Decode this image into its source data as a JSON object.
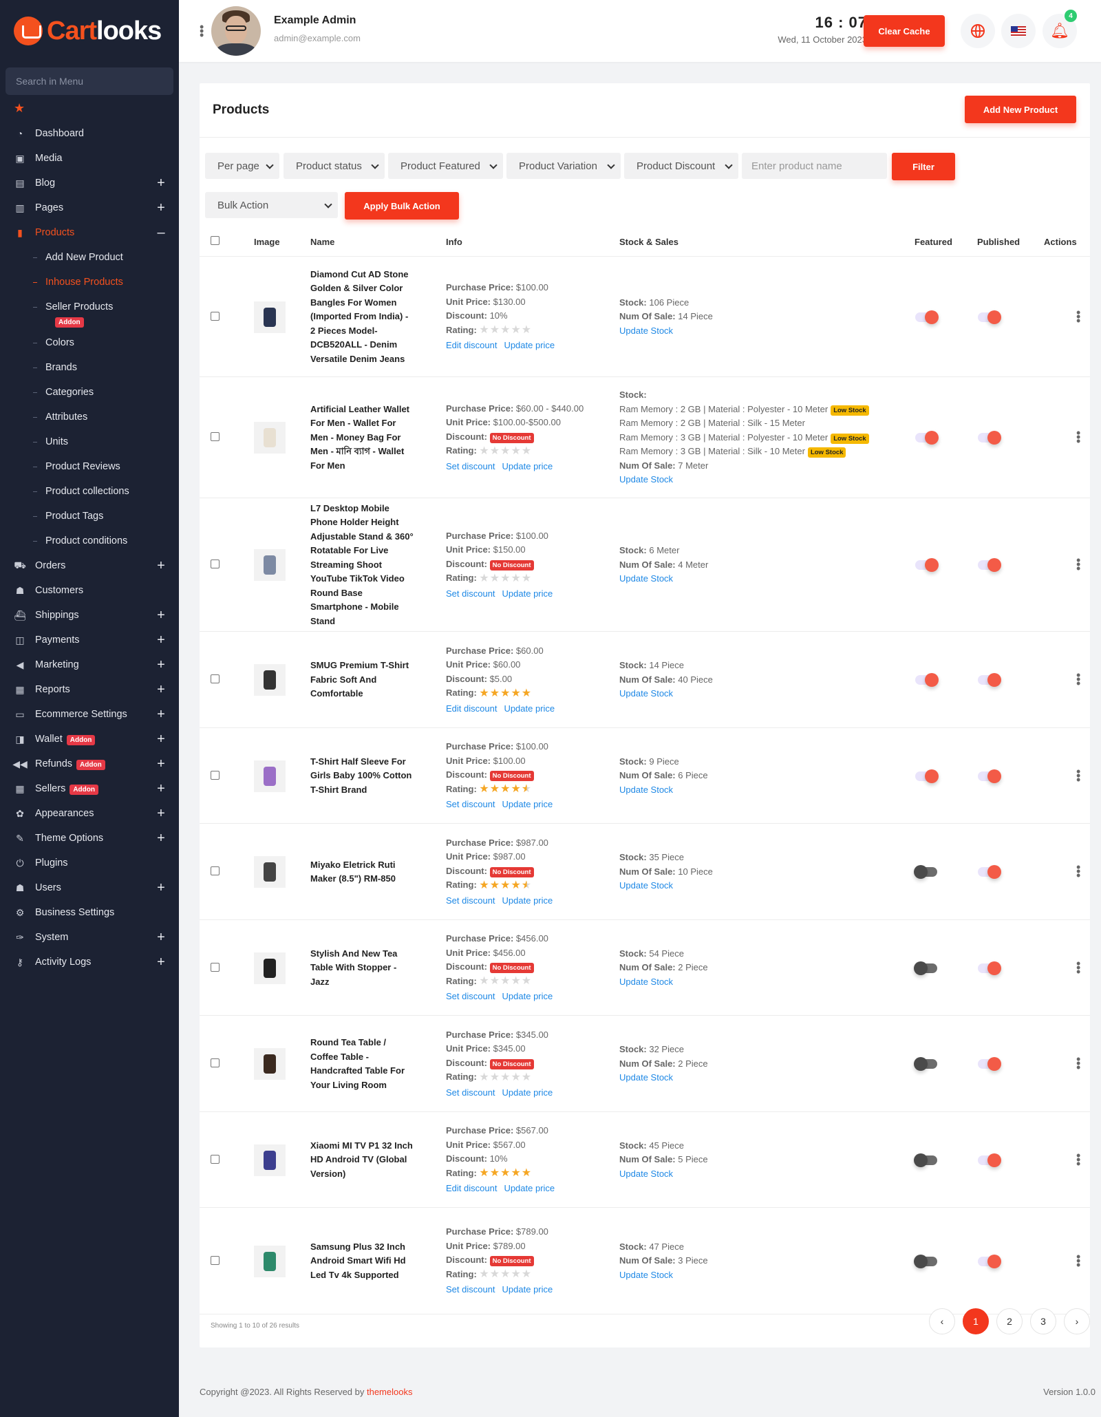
{
  "brand": {
    "part1": "Cart",
    "part2": "looks"
  },
  "sidebar": {
    "search_placeholder": "Search in Menu",
    "items": [
      {
        "label": "Dashboard",
        "icon": "speedometer-icon",
        "expandable": false
      },
      {
        "label": "Media",
        "icon": "media-icon",
        "expandable": false
      },
      {
        "label": "Blog",
        "icon": "blog-icon",
        "expandable": true
      },
      {
        "label": "Pages",
        "icon": "pages-icon",
        "expandable": true
      },
      {
        "label": "Products",
        "icon": "bag-icon",
        "expandable": true,
        "active": true
      }
    ],
    "product_sub": [
      "Add New Product",
      "Inhouse Products",
      "Seller Products",
      "Colors",
      "Brands",
      "Categories",
      "Attributes",
      "Units",
      "Product Reviews",
      "Product collections",
      "Product Tags",
      "Product conditions"
    ],
    "addon_label": "Addon",
    "items2": [
      {
        "label": "Orders",
        "icon": "cart-icon",
        "expandable": true
      },
      {
        "label": "Customers",
        "icon": "users-icon",
        "expandable": false
      },
      {
        "label": "Shippings",
        "icon": "ship-icon",
        "expandable": true
      },
      {
        "label": "Payments",
        "icon": "wallet-icon",
        "expandable": true
      },
      {
        "label": "Marketing",
        "icon": "megaphone-icon",
        "expandable": true
      },
      {
        "label": "Reports",
        "icon": "report-icon",
        "expandable": true
      },
      {
        "label": "Ecommerce Settings",
        "icon": "window-icon",
        "expandable": true
      },
      {
        "label": "Wallet",
        "icon": "wallet2-icon",
        "expandable": true,
        "addon": true
      },
      {
        "label": "Refunds",
        "icon": "rewind-icon",
        "expandable": true,
        "addon": true
      },
      {
        "label": "Sellers",
        "icon": "seller-icon",
        "expandable": true,
        "addon": true
      },
      {
        "label": "Appearances",
        "icon": "palette-icon",
        "expandable": true
      },
      {
        "label": "Theme Options",
        "icon": "brush-icon",
        "expandable": true
      },
      {
        "label": "Plugins",
        "icon": "plug-icon",
        "expandable": false
      },
      {
        "label": "Users",
        "icon": "users-icon",
        "expandable": true
      },
      {
        "label": "Business Settings",
        "icon": "gears-icon",
        "expandable": false
      },
      {
        "label": "System",
        "icon": "wrench-icon",
        "expandable": true
      },
      {
        "label": "Activity Logs",
        "icon": "key-icon",
        "expandable": true
      }
    ]
  },
  "header": {
    "user_name": "Example Admin",
    "user_email": "admin@example.com",
    "time": "16 : 07",
    "date": "Wed, 11 October 2023",
    "clear_cache": "Clear Cache",
    "notifications": "4"
  },
  "page": {
    "title": "Products",
    "add_button": "Add New Product",
    "filters": {
      "per_page": "Per page",
      "status": "Product status",
      "featured": "Product Featured",
      "variation": "Product Variation",
      "discount": "Product Discount",
      "name_placeholder": "Enter product name",
      "filter_button": "Filter",
      "bulk_action": "Bulk Action",
      "apply_bulk": "Apply Bulk Action"
    },
    "columns": {
      "image": "Image",
      "name": "Name",
      "info": "Info",
      "stock": "Stock & Sales",
      "featured": "Featured",
      "published": "Published",
      "actions": "Actions"
    },
    "labels": {
      "purchase_price": "Purchase Price:",
      "unit_price": "Unit Price:",
      "discount": "Discount:",
      "rating": "Rating:",
      "stock": "Stock:",
      "num_sale": "Num Of Sale:",
      "update_stock": "Update Stock",
      "update_price": "Update price",
      "no_discount": "No Discount",
      "low_stock": "Low Stock"
    },
    "products": [
      {
        "name": "Diamond Cut AD Stone Golden & Silver Color Bangles For Women (Imported From India) - 2 Pieces Model-DCB520ALL - Denim Versatile Denim Jeans",
        "purchase": "$100.00",
        "unit": "$130.00",
        "discount": "10%",
        "rating": 0,
        "discount_link": "Edit discount",
        "stock": "106 Piece",
        "sales": "14 Piece",
        "featured": true,
        "published": true,
        "icon": "jacket-icon",
        "color": "#2a3552"
      },
      {
        "name": "Artificial Leather Wallet For Men - Wallet For Men - Money Bag For Men - মানি ব্যাগ - Wallet For Men",
        "purchase": "$60.00 - $440.00",
        "unit": "$100.00-$500.00",
        "discount": null,
        "rating": 0,
        "discount_link": "Set discount",
        "stock": null,
        "variants": [
          {
            "text": "Ram Memory : 2 GB | Material : Polyester - 10 Meter",
            "low": true
          },
          {
            "text": "Ram Memory : 2 GB | Material : Silk - 15 Meter",
            "low": false
          },
          {
            "text": "Ram Memory : 3 GB | Material : Polyester - 10 Meter",
            "low": true
          },
          {
            "text": "Ram Memory : 3 GB | Material : Silk - 10 Meter",
            "low": true
          }
        ],
        "sales": "7 Meter",
        "featured": true,
        "published": true,
        "icon": "dress-icon",
        "color": "#e8e0d2"
      },
      {
        "name": "L7 Desktop Mobile Phone Holder Height Adjustable Stand & 360° Rotatable For Live Streaming Shoot YouTube TikTok Video Round Base Smartphone - Mobile Stand",
        "purchase": "$100.00",
        "unit": "$150.00",
        "discount": null,
        "rating": 0,
        "discount_link": "Set discount",
        "stock": "6 Meter",
        "sales": "4 Meter",
        "featured": true,
        "published": true,
        "icon": "coat-icon",
        "color": "#7d8aa3"
      },
      {
        "name": "SMUG Premium T-Shirt Fabric Soft And Comfortable",
        "purchase": "$60.00",
        "unit": "$60.00",
        "discount": "$5.00",
        "rating": 5,
        "discount_link": "Edit discount",
        "stock": "14 Piece",
        "sales": "40 Piece",
        "featured": true,
        "published": true,
        "icon": "speaker-icon",
        "color": "#333333"
      },
      {
        "name": "T-Shirt Half Sleeve For Girls Baby 100% Cotton T-Shirt Brand",
        "purchase": "$100.00",
        "unit": "$100.00",
        "discount": null,
        "rating": 4.5,
        "discount_link": "Set discount",
        "stock": "9 Piece",
        "sales": "6 Piece",
        "featured": true,
        "published": true,
        "icon": "frock-icon",
        "color": "#9b6fc7"
      },
      {
        "name": "Miyako Eletrick Ruti Maker (8.5\") RM-850",
        "purchase": "$987.00",
        "unit": "$987.00",
        "discount": null,
        "rating": 4.5,
        "discount_link": "Set discount",
        "stock": "35 Piece",
        "sales": "10 Piece",
        "featured": false,
        "published": true,
        "icon": "appliance-icon",
        "color": "#444444"
      },
      {
        "name": "Stylish And New Tea Table With Stopper - Jazz",
        "purchase": "$456.00",
        "unit": "$456.00",
        "discount": null,
        "rating": 0,
        "discount_link": "Set discount",
        "stock": "54 Piece",
        "sales": "2 Piece",
        "featured": false,
        "published": true,
        "icon": "table-icon",
        "color": "#222222"
      },
      {
        "name": "Round Tea Table / Coffee Table - Handcrafted Table For Your Living Room",
        "purchase": "$345.00",
        "unit": "$345.00",
        "discount": null,
        "rating": 0,
        "discount_link": "Set discount",
        "stock": "32 Piece",
        "sales": "2 Piece",
        "featured": false,
        "published": true,
        "icon": "round-table-icon",
        "color": "#3b2a20"
      },
      {
        "name": "Xiaomi MI TV P1 32 Inch HD Android TV (Global Version)",
        "purchase": "$567.00",
        "unit": "$567.00",
        "discount": "10%",
        "rating": 5,
        "discount_link": "Edit discount",
        "stock": "45 Piece",
        "sales": "5 Piece",
        "featured": false,
        "published": true,
        "icon": "tv-icon",
        "color": "#3d3f8f"
      },
      {
        "name": "Samsung Plus 32 Inch Android Smart Wifi Hd Led Tv 4k Supported",
        "purchase": "$789.00",
        "unit": "$789.00",
        "discount": null,
        "rating": 0,
        "discount_link": "Set discount",
        "stock": "47 Piece",
        "sales": "3 Piece",
        "featured": false,
        "published": true,
        "icon": "tv-icon",
        "color": "#2e8a6b"
      }
    ],
    "showing": "Showing 1 to 10 of 26 results",
    "pagination": [
      "‹",
      "1",
      "2",
      "3",
      "›"
    ],
    "current_page": "1"
  },
  "footer": {
    "copyright": "Copyright @2023. All Rights Reserved by ",
    "brand_link": "themelooks",
    "version": "Version 1.0.0"
  },
  "colors": {
    "accent": "#f3371d",
    "sidebar_bg": "#1c2233",
    "link": "#1e88e5"
  }
}
